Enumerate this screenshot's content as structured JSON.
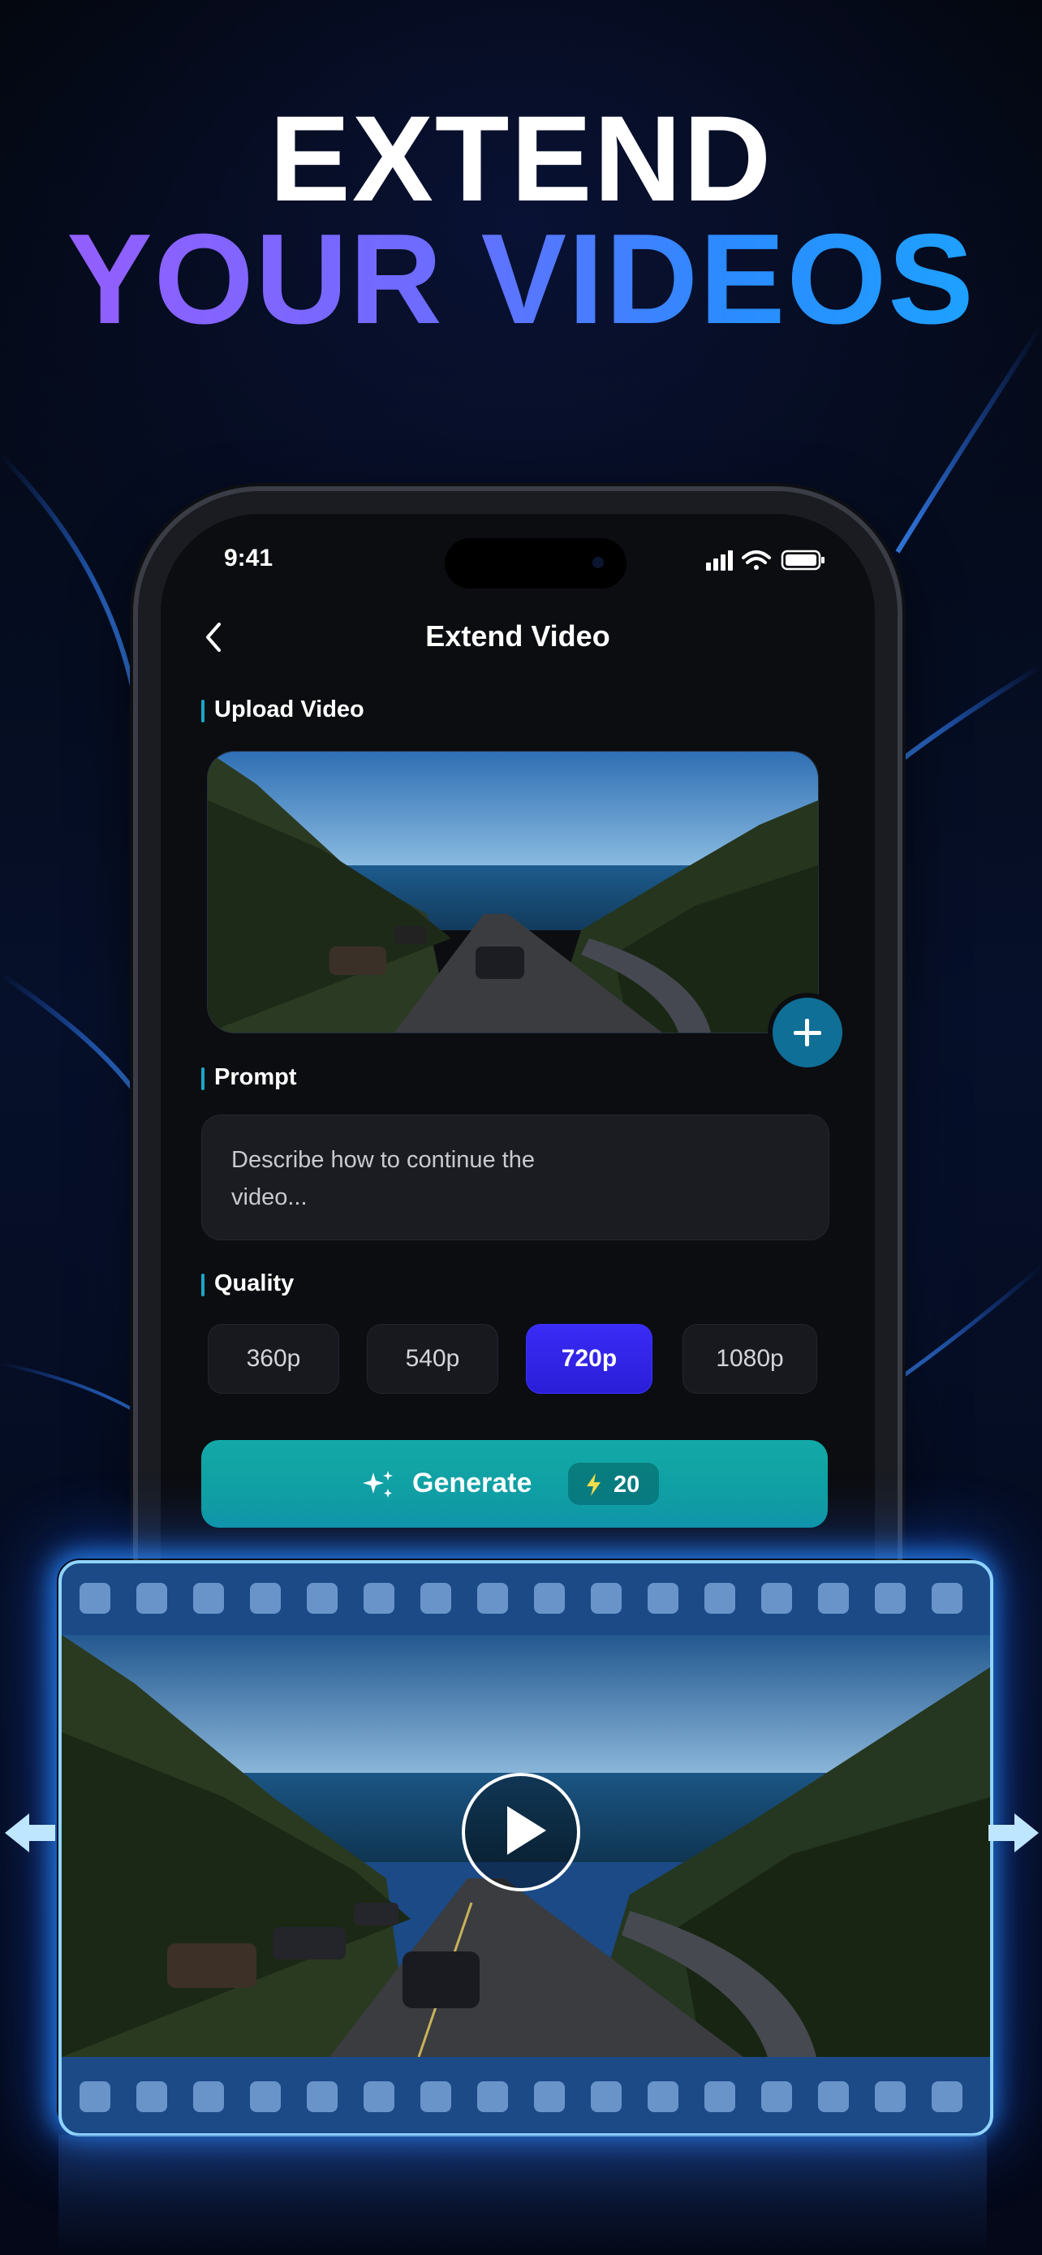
{
  "headline": {
    "line1": "EXTEND",
    "line2": "YOUR VIDEOS"
  },
  "status_bar": {
    "time": "9:41"
  },
  "screen": {
    "title": "Extend Video",
    "upload_label": "Upload Video",
    "prompt_label": "Prompt",
    "prompt_placeholder": "Describe how to continue the video...",
    "quality_label": "Quality",
    "quality_options": [
      "360p",
      "540p",
      "720p",
      "1080p"
    ],
    "selected_quality": "720p",
    "generate_label": "Generate",
    "credit_cost": "20"
  },
  "colors": {
    "accent_teal": "#13a8a8",
    "selected_purple": "#3a2cf5",
    "headline_gradient_start": "#9b5cff",
    "headline_gradient_end": "#1aa7ff"
  },
  "icons": [
    "back-chevron-icon",
    "signal-icon",
    "wifi-icon",
    "battery-icon",
    "plus-icon",
    "sparkle-icon",
    "bolt-icon",
    "play-icon",
    "left-arrow-icon",
    "right-arrow-icon"
  ]
}
